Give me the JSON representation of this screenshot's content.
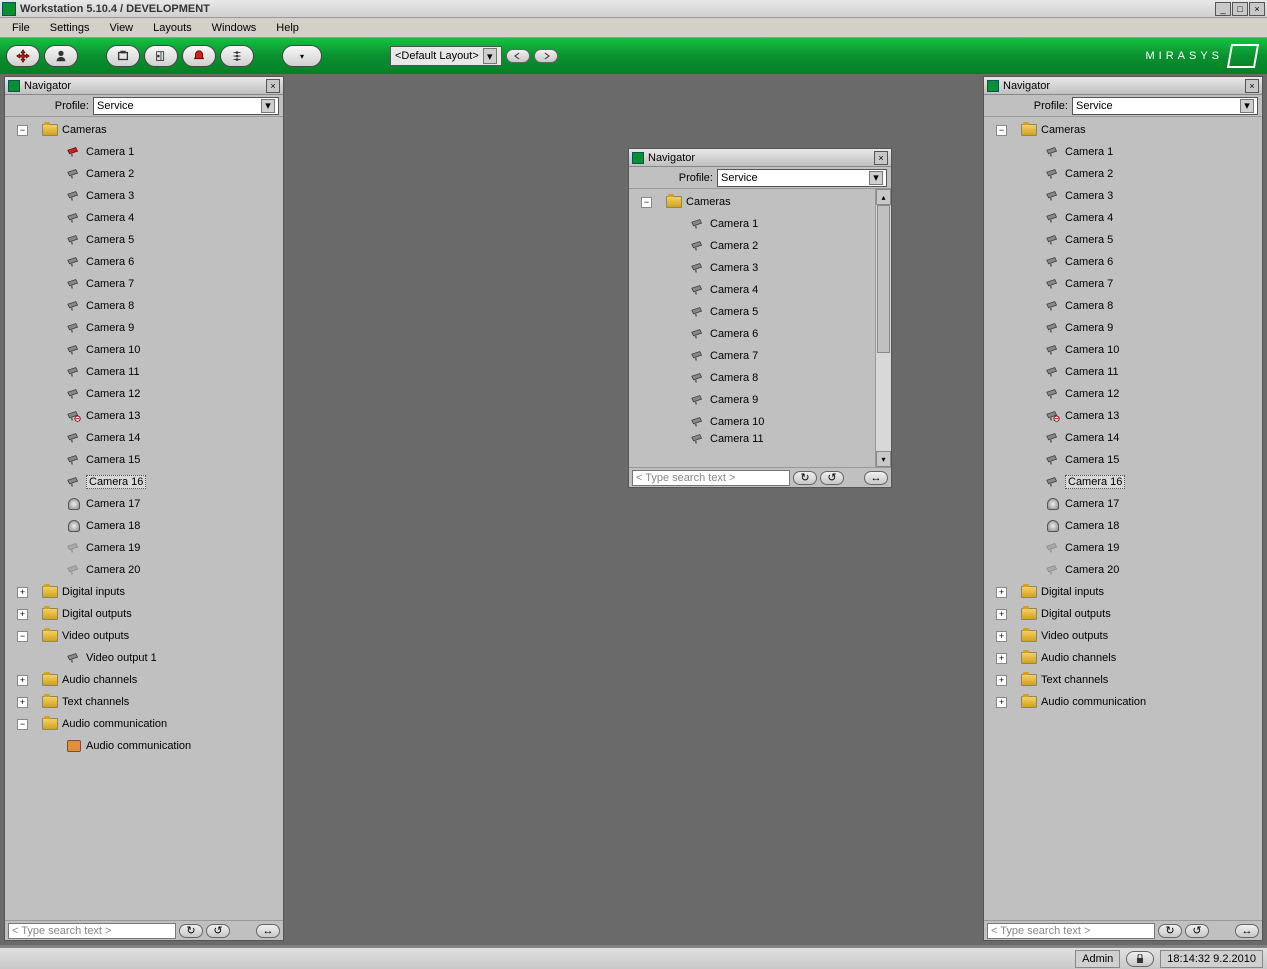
{
  "title": "Workstation 5.10.4 / DEVELOPMENT",
  "menu": [
    "File",
    "Settings",
    "View",
    "Layouts",
    "Windows",
    "Help"
  ],
  "toolbar": {
    "layout_label": "<Default Layout>"
  },
  "brand": "MIRASYS",
  "navigator": {
    "title": "Navigator",
    "profile_label": "Profile:",
    "profile_value": "Service",
    "search_placeholder": "< Type search text >"
  },
  "left_tree": [
    {
      "type": "folder",
      "label": "Cameras",
      "exp": "-",
      "depth": 0
    },
    {
      "type": "cam",
      "label": "Camera 1",
      "depth": 1,
      "variant": "red"
    },
    {
      "type": "cam",
      "label": "Camera 2",
      "depth": 1
    },
    {
      "type": "cam",
      "label": "Camera 3",
      "depth": 1
    },
    {
      "type": "cam",
      "label": "Camera 4",
      "depth": 1
    },
    {
      "type": "cam",
      "label": "Camera 5",
      "depth": 1
    },
    {
      "type": "cam",
      "label": "Camera 6",
      "depth": 1
    },
    {
      "type": "cam",
      "label": "Camera 7",
      "depth": 1
    },
    {
      "type": "cam",
      "label": "Camera 8",
      "depth": 1
    },
    {
      "type": "cam",
      "label": "Camera 9",
      "depth": 1
    },
    {
      "type": "cam",
      "label": "Camera 10",
      "depth": 1
    },
    {
      "type": "cam",
      "label": "Camera 11",
      "depth": 1
    },
    {
      "type": "cam",
      "label": "Camera 12",
      "depth": 1
    },
    {
      "type": "cam",
      "label": "Camera 13",
      "depth": 1,
      "variant": "badge"
    },
    {
      "type": "cam",
      "label": "Camera 14",
      "depth": 1
    },
    {
      "type": "cam",
      "label": "Camera 15",
      "depth": 1
    },
    {
      "type": "cam",
      "label": "Camera 16",
      "depth": 1,
      "selected": true
    },
    {
      "type": "dome",
      "label": "Camera 17",
      "depth": 1
    },
    {
      "type": "dome",
      "label": "Camera 18",
      "depth": 1
    },
    {
      "type": "cam",
      "label": "Camera 19",
      "depth": 1,
      "variant": "dim"
    },
    {
      "type": "cam",
      "label": "Camera 20",
      "depth": 1,
      "variant": "dim"
    },
    {
      "type": "folder",
      "label": "Digital inputs",
      "exp": "+",
      "depth": 0
    },
    {
      "type": "folder",
      "label": "Digital outputs",
      "exp": "+",
      "depth": 0
    },
    {
      "type": "folder",
      "label": "Video outputs",
      "exp": "-",
      "depth": 0
    },
    {
      "type": "cam",
      "label": "Video output 1",
      "depth": 1
    },
    {
      "type": "folder",
      "label": "Audio channels",
      "exp": "+",
      "depth": 0
    },
    {
      "type": "folder",
      "label": "Text channels",
      "exp": "+",
      "depth": 0
    },
    {
      "type": "folder",
      "label": "Audio communication",
      "exp": "-",
      "depth": 0
    },
    {
      "type": "audio",
      "label": "Audio communication",
      "depth": 1
    }
  ],
  "float_tree": [
    {
      "type": "folder",
      "label": "Cameras",
      "exp": "-",
      "depth": 0
    },
    {
      "type": "cam",
      "label": "Camera 1",
      "depth": 1
    },
    {
      "type": "cam",
      "label": "Camera 2",
      "depth": 1
    },
    {
      "type": "cam",
      "label": "Camera 3",
      "depth": 1
    },
    {
      "type": "cam",
      "label": "Camera 4",
      "depth": 1
    },
    {
      "type": "cam",
      "label": "Camera 5",
      "depth": 1
    },
    {
      "type": "cam",
      "label": "Camera 6",
      "depth": 1
    },
    {
      "type": "cam",
      "label": "Camera 7",
      "depth": 1
    },
    {
      "type": "cam",
      "label": "Camera 8",
      "depth": 1
    },
    {
      "type": "cam",
      "label": "Camera 9",
      "depth": 1
    },
    {
      "type": "cam",
      "label": "Camera 10",
      "depth": 1
    },
    {
      "type": "cam",
      "label": "Camera 11",
      "depth": 1,
      "cut": true
    }
  ],
  "right_tree": [
    {
      "type": "folder",
      "label": "Cameras",
      "exp": "-",
      "depth": 0
    },
    {
      "type": "cam",
      "label": "Camera 1",
      "depth": 1
    },
    {
      "type": "cam",
      "label": "Camera 2",
      "depth": 1
    },
    {
      "type": "cam",
      "label": "Camera 3",
      "depth": 1
    },
    {
      "type": "cam",
      "label": "Camera 4",
      "depth": 1
    },
    {
      "type": "cam",
      "label": "Camera 5",
      "depth": 1
    },
    {
      "type": "cam",
      "label": "Camera 6",
      "depth": 1
    },
    {
      "type": "cam",
      "label": "Camera 7",
      "depth": 1
    },
    {
      "type": "cam",
      "label": "Camera 8",
      "depth": 1
    },
    {
      "type": "cam",
      "label": "Camera 9",
      "depth": 1
    },
    {
      "type": "cam",
      "label": "Camera 10",
      "depth": 1
    },
    {
      "type": "cam",
      "label": "Camera 11",
      "depth": 1
    },
    {
      "type": "cam",
      "label": "Camera 12",
      "depth": 1
    },
    {
      "type": "cam",
      "label": "Camera 13",
      "depth": 1,
      "variant": "badge"
    },
    {
      "type": "cam",
      "label": "Camera 14",
      "depth": 1
    },
    {
      "type": "cam",
      "label": "Camera 15",
      "depth": 1
    },
    {
      "type": "cam",
      "label": "Camera 16",
      "depth": 1,
      "selected": true
    },
    {
      "type": "dome",
      "label": "Camera 17",
      "depth": 1
    },
    {
      "type": "dome",
      "label": "Camera 18",
      "depth": 1
    },
    {
      "type": "cam",
      "label": "Camera 19",
      "depth": 1,
      "variant": "dim"
    },
    {
      "type": "cam",
      "label": "Camera 20",
      "depth": 1,
      "variant": "dim"
    },
    {
      "type": "folder",
      "label": "Digital inputs",
      "exp": "+",
      "depth": 0
    },
    {
      "type": "folder",
      "label": "Digital outputs",
      "exp": "+",
      "depth": 0
    },
    {
      "type": "folder",
      "label": "Video outputs",
      "exp": "+",
      "depth": 0
    },
    {
      "type": "folder",
      "label": "Audio channels",
      "exp": "+",
      "depth": 0
    },
    {
      "type": "folder",
      "label": "Text channels",
      "exp": "+",
      "depth": 0
    },
    {
      "type": "folder",
      "label": "Audio communication",
      "exp": "+",
      "depth": 0
    }
  ],
  "status": {
    "user": "Admin",
    "datetime": "18:14:32 9.2.2010"
  }
}
